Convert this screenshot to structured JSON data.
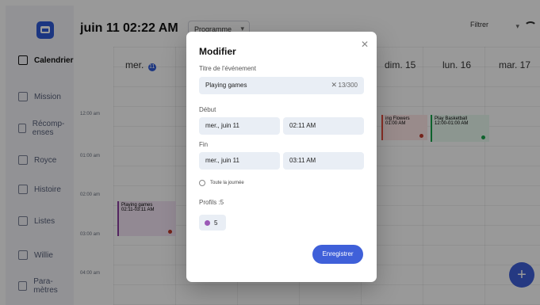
{
  "app": {
    "date_title": "juin 11",
    "time_title": "02:22 AM",
    "program_label": "Programme",
    "filter_label": "Filtrer"
  },
  "sidebar": {
    "items": [
      {
        "label": "Calendrier",
        "icon": "calendar-icon"
      },
      {
        "label": "Mission",
        "icon": "mission-icon"
      },
      {
        "label": "Récomp-enses",
        "icon": "reward-icon"
      },
      {
        "label": "Royce",
        "icon": "royce-icon"
      },
      {
        "label": "Histoire",
        "icon": "history-icon"
      },
      {
        "label": "Listes",
        "icon": "list-icon"
      },
      {
        "label": "Willie",
        "icon": "settings-icon"
      },
      {
        "label": "Para-mètres",
        "icon": "gear-icon"
      }
    ]
  },
  "calendar": {
    "columns": [
      "mer.",
      "dim. 15",
      "lun. 16",
      "mar. 17"
    ],
    "selected_badge": "11",
    "hours": [
      "12:00 am",
      "01:00 am",
      "02:00 am",
      "03:00 am",
      "04:00 am"
    ],
    "events": [
      {
        "title": "Playing games",
        "time": "02:11-03:11 AM",
        "dot_color": "#c0392b",
        "count": "5"
      },
      {
        "title": "ing Flowers",
        "time": "01:00 AM",
        "dot_color": "#c0392b",
        "count": "5"
      },
      {
        "title": "Play Basketball",
        "time": "12:00-01:00 AM",
        "dot_color": "#16a34a",
        "count": "5"
      }
    ],
    "fab_label": "+"
  },
  "modal": {
    "title": "Modifier",
    "event_title_label": "Titre de l'événement",
    "event_title_value": "Playing games",
    "event_title_count": "13/300",
    "start_label": "Début",
    "start_date": "mer., juin 11",
    "start_time": "02:11 AM",
    "end_label": "Fin",
    "end_date": "mer., juin 11",
    "end_time": "03:11 AM",
    "all_day_label": "Toute la journée",
    "profiles_label": "Profils :5",
    "profile_count": "5",
    "save_label": "Enregistrer",
    "profile_dot_color": "#9b59b6",
    "accent_color": "#3f60d9"
  }
}
